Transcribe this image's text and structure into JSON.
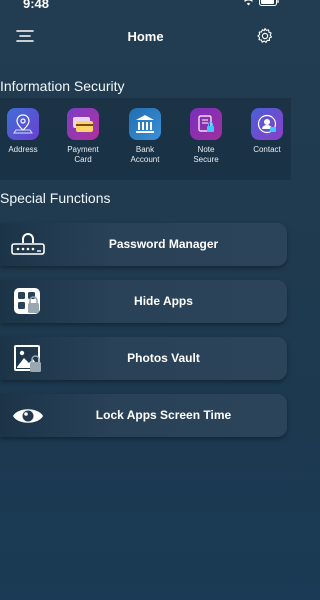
{
  "status_bar": {
    "time": "9:48"
  },
  "header": {
    "title": "Home"
  },
  "info_section": {
    "title": "Information Security",
    "items": [
      {
        "label": "Address",
        "icon": "location-icon"
      },
      {
        "label": "Payment\nCard",
        "icon": "credit-card-icon"
      },
      {
        "label": "Bank\nAccount",
        "icon": "bank-icon"
      },
      {
        "label": "Note\nSecure",
        "icon": "note-lock-icon"
      },
      {
        "label": "Contact",
        "icon": "contact-lock-icon"
      }
    ]
  },
  "special_section": {
    "title": "Special Functions",
    "items": [
      {
        "label": "Password Manager",
        "icon": "password-lock-icon"
      },
      {
        "label": "Hide Apps",
        "icon": "apps-lock-icon"
      },
      {
        "label": "Photos Vault",
        "icon": "photo-lock-icon"
      },
      {
        "label": "Lock Apps Screen Time",
        "icon": "eye-icon"
      }
    ]
  },
  "colors": {
    "background": "#203b50",
    "accent_purple": "#6a3fd0",
    "accent_blue": "#1f6fb0"
  }
}
